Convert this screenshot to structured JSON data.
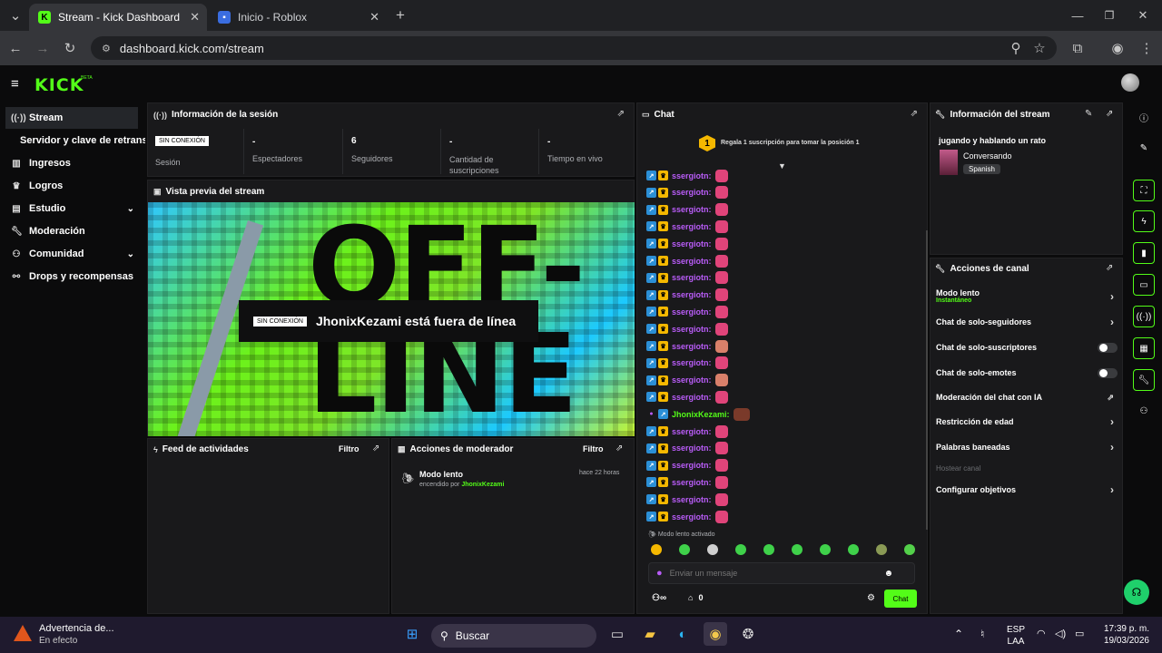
{
  "browser": {
    "tabs": [
      {
        "label": "Stream - Kick Dashboard",
        "icon": "kick-icon",
        "active": true
      },
      {
        "label": "Inicio - Roblox",
        "icon": "roblox-icon",
        "active": false
      }
    ],
    "url": "dashboard.kick.com/stream"
  },
  "app": {
    "logo": "KICK",
    "beta": "BETA"
  },
  "sidebar": {
    "items": [
      {
        "label": "Stream",
        "icon": "broadcast-icon"
      },
      {
        "label": "Servidor y clave de retransmisión",
        "icon": ""
      },
      {
        "label": "Ingresos",
        "icon": "chart-icon"
      },
      {
        "label": "Logros",
        "icon": "trophy-icon"
      },
      {
        "label": "Estudio",
        "icon": "studio-icon"
      },
      {
        "label": "Moderación",
        "icon": "wrench-icon"
      },
      {
        "label": "Comunidad",
        "icon": "community-icon"
      },
      {
        "label": "Drops y recompensas",
        "icon": "drops-icon"
      }
    ]
  },
  "session": {
    "title": "Información de la sesión",
    "status_badge": "SIN CONEXIÓN",
    "status_label": "Sesión",
    "viewers_value": "-",
    "viewers_label": "Espectadores",
    "followers_value": "6",
    "followers_label": "Seguidores",
    "subs_value": "-",
    "subs_label": "Cantidad de suscripciones",
    "time_value": "-",
    "time_label": "Tiempo en vivo"
  },
  "preview": {
    "title": "Vista previa del stream",
    "badge": "SIN CONEXIÓN",
    "offline_text": "JhonixKezami está fuera de línea",
    "art_text": "OFF-LINE"
  },
  "feed": {
    "title": "Feed de actividades",
    "filter": "Filtro"
  },
  "modactions": {
    "title": "Acciones de moderador",
    "filter": "Filtro",
    "item_title": "Modo lento",
    "item_time": "hace 22 horas",
    "item_by_prefix": "encendido por",
    "item_by_user": "JhonixKezami"
  },
  "chat": {
    "title": "Chat",
    "gift_rank": "1",
    "gift_text": "Regala 1 suscripción para tomar la posición 1",
    "messages": [
      {
        "user": "ssergiotn:"
      },
      {
        "user": "ssergiotn:"
      },
      {
        "user": "ssergiotn:"
      },
      {
        "user": "ssergiotn:"
      },
      {
        "user": "ssergiotn:"
      },
      {
        "user": "ssergiotn:"
      },
      {
        "user": "ssergiotn:"
      },
      {
        "user": "ssergiotn:"
      },
      {
        "user": "ssergiotn:"
      },
      {
        "user": "ssergiotn:"
      },
      {
        "user": "ssergiotn:"
      },
      {
        "user": "ssergiotn:"
      },
      {
        "user": "ssergiotn:"
      },
      {
        "user": "ssergiotn:"
      },
      {
        "user": "JhonixKezami:"
      },
      {
        "user": "ssergiotn:"
      },
      {
        "user": "ssergiotn:"
      },
      {
        "user": "ssergiotn:"
      },
      {
        "user": "ssergiotn:"
      },
      {
        "user": "ssergiotn:"
      },
      {
        "user": "ssergiotn:"
      }
    ],
    "slow_mode_text": "Modo lento activado",
    "input_placeholder": "Enviar un mensaje",
    "points_value": "0",
    "send_label": "Chat",
    "user_color": "#b95cf8",
    "owner_color": "#53fc18"
  },
  "streaminfo": {
    "title": "Información del stream",
    "stream_title": "jugando y hablando un rato",
    "category": "Conversando",
    "language": "Spanish"
  },
  "channel_actions": {
    "title": "Acciones de canal",
    "slow_mode": "Modo lento",
    "slow_mode_sub": "Instantáneo",
    "followers_only": "Chat de solo-seguidores",
    "subs_only": "Chat de solo-suscriptores",
    "emotes_only": "Chat de solo-emotes",
    "ai_moderation": "Moderación del chat con IA",
    "age_restriction": "Restricción de edad",
    "banned_words": "Palabras baneadas",
    "host": "Hostear canal",
    "goals": "Configurar objetivos"
  },
  "taskbar": {
    "weather_title": "Advertencia de...",
    "weather_sub": "En efecto",
    "search": "Buscar",
    "lang1": "ESP",
    "lang2": "LAA",
    "time": "17:39 p. m.",
    "date": "19/03/2026"
  },
  "colors": {
    "accent": "#53fc18",
    "panel": "#19191b",
    "bg": "#0b0b0c"
  }
}
